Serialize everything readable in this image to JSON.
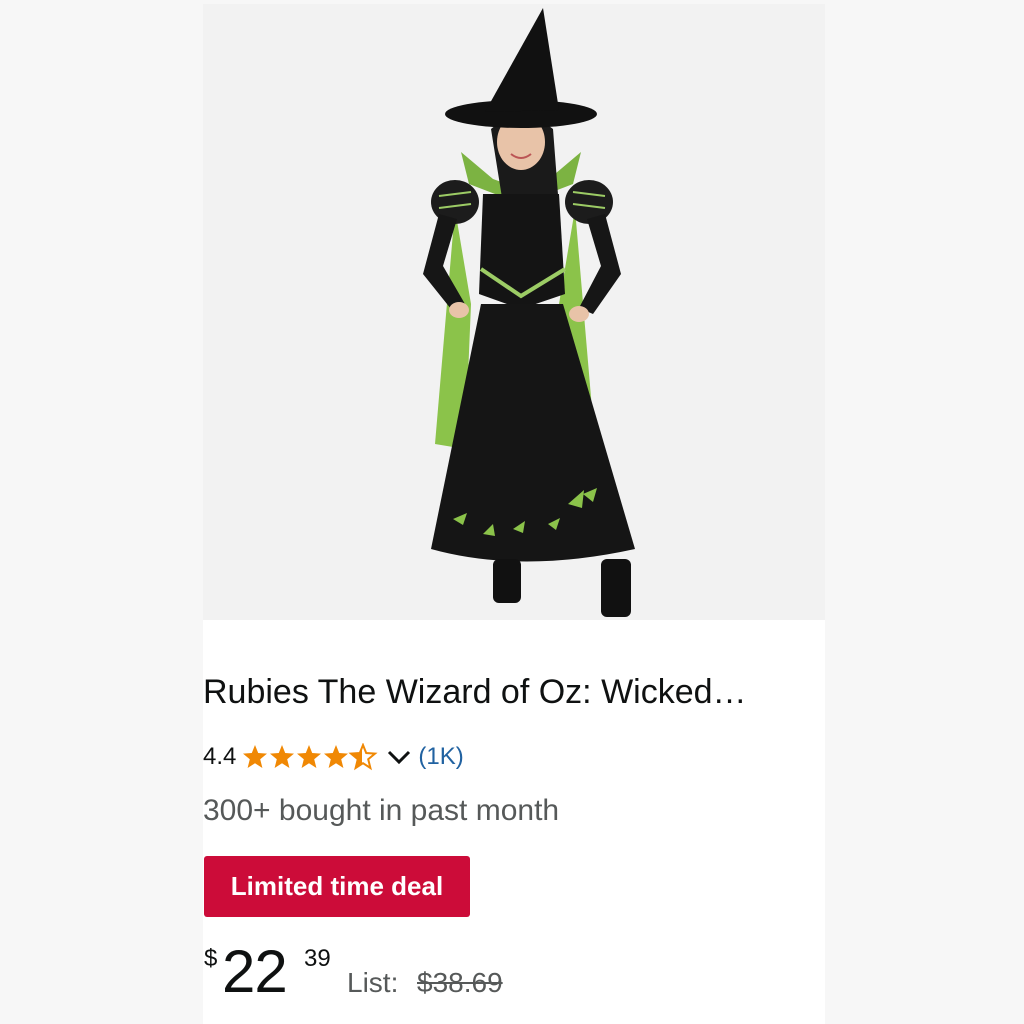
{
  "product": {
    "image_alt": "witch-costume-photo",
    "title": "Rubies The Wizard of Oz: Wicked…",
    "rating": "4.4",
    "rating_stars": 4.4,
    "review_count": "(1K)",
    "bought_text": "300+ bought in past month",
    "deal_badge": "Limited time deal",
    "price": {
      "symbol": "$",
      "whole": "22",
      "fraction": "39"
    },
    "list_label": "List:",
    "list_price": "$38.69"
  },
  "icons": {
    "star": "star-icon",
    "chevron": "chevron-down-icon"
  },
  "colors": {
    "star": "#f08804",
    "link": "#2162a1",
    "deal_badge": "#cc0c39",
    "costume_black": "#151515",
    "costume_green": "#8bc34a"
  }
}
